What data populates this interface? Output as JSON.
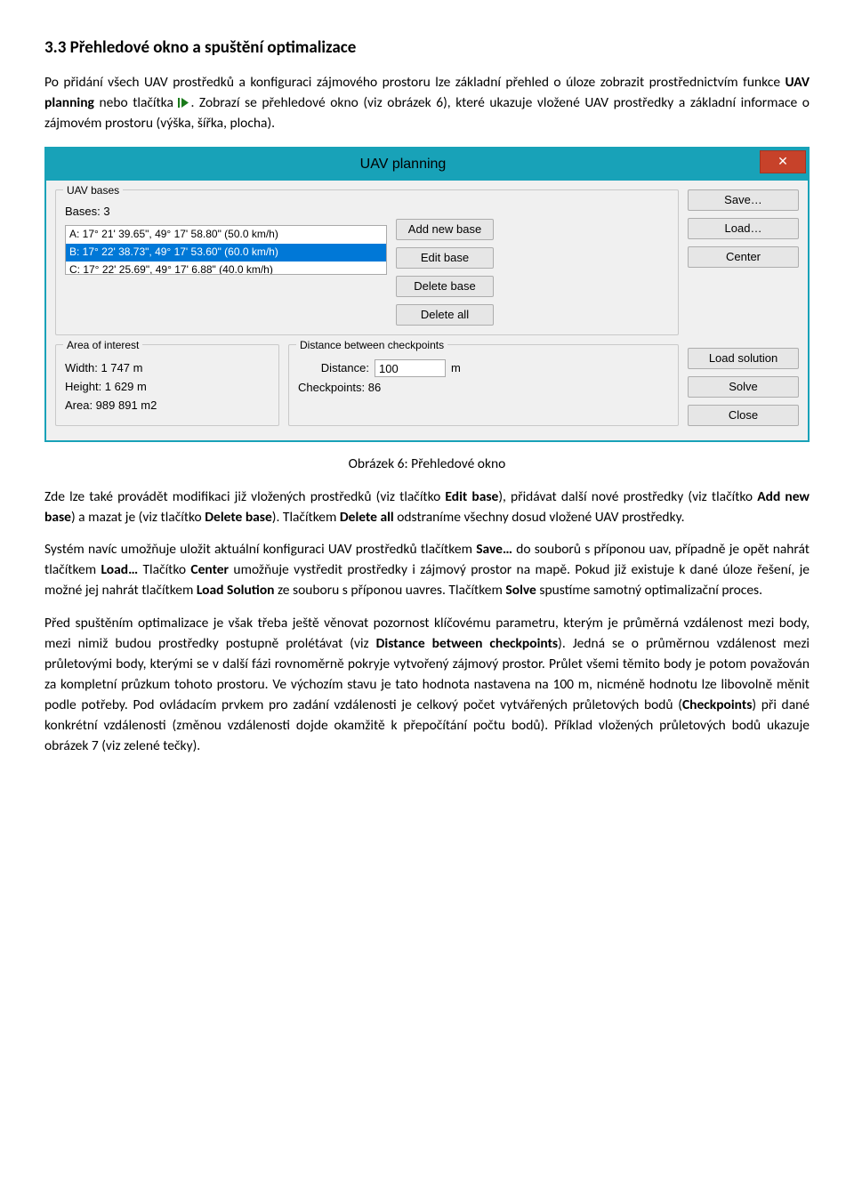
{
  "heading": "3.3 Přehledové okno a spuštění optimalizace",
  "para1": {
    "t1": "Po přidání všech UAV prostředků a konfiguraci zájmového prostoru lze základní přehled o úloze zobrazit prostřednictvím funkce ",
    "b1": "UAV planning",
    "t2": " nebo tlačítka ",
    "t3": ". Zobrazí se přehledové okno (viz obrázek 6), které ukazuje vložené UAV prostředky a základní informace o zájmovém prostoru (výška, šířka, plocha)."
  },
  "win": {
    "title": "UAV planning",
    "close": "✕",
    "bases_group": "UAV bases",
    "bases_label": "Bases:  3",
    "list": {
      "a": "A: 17° 21' 39.65\", 49° 17' 58.80\" (50.0 km/h)",
      "b": "B: 17° 22' 38.73\", 49° 17' 53.60\" (60.0 km/h)",
      "c": "C: 17° 22' 25.69\", 49° 17' 6.88\" (40.0 km/h)"
    },
    "btn_add": "Add new base",
    "btn_edit": "Edit base",
    "btn_delete": "Delete base",
    "btn_delete_all": "Delete all",
    "aoi_group": "Area of interest",
    "width": "Width:   1 747 m",
    "height": "Height:  1 629 m",
    "area": "Area:    989 891 m2",
    "dist_group": "Distance between checkpoints",
    "dist_label": "Distance:",
    "dist_value": "100",
    "dist_unit": "m",
    "chk_label": "Checkpoints:  86",
    "btn_save": "Save…",
    "btn_load": "Load…",
    "btn_center": "Center",
    "btn_loadsol": "Load solution",
    "btn_solve": "Solve",
    "btn_close2": "Close"
  },
  "caption": "Obrázek 6: Přehledové okno",
  "para2": {
    "t1": "Zde lze také provádět modifikaci již vložených prostředků (viz tlačítko ",
    "b1": "Edit base",
    "t2": "), přidávat další nové prostředky (viz tlačítko ",
    "b2": "Add new base",
    "t3": ") a mazat je (viz tlačítko ",
    "b3": "Delete base",
    "t4": "). Tlačítkem ",
    "b4": "Delete all",
    "t5": " odstraníme všechny dosud vložené UAV prostředky."
  },
  "para3": {
    "t1": "Systém navíc umožňuje uložit aktuální konfiguraci UAV prostředků tlačítkem ",
    "b1": "Save…",
    "t2": " do souborů s příponou uav, případně je opět nahrát tlačítkem ",
    "b2": "Load…",
    "t3": " Tlačítko ",
    "b3": "Center",
    "t4": " umožňuje vystředit prostředky i zájmový prostor na mapě. Pokud již existuje k dané úloze řešení, je možné jej nahrát tlačítkem ",
    "b4": "Load Solution",
    "t5": " ze souboru s příponou uavres. Tlačítkem ",
    "b5": "Solve",
    "t6": " spustíme samotný optimalizační proces."
  },
  "para4": {
    "t1": "Před spuštěním optimalizace je však třeba ještě věnovat pozornost klíčovému parametru, kterým je průměrná vzdálenost mezi body, mezi nimiž budou prostředky postupně prolétávat (viz ",
    "b1": "Distance between checkpoints",
    "t2": "). Jedná se o průměrnou vzdálenost mezi průletovými body, kterými se v další fázi rovnoměrně pokryje vytvořený zájmový prostor. Průlet všemi těmito body je potom považován za kompletní průzkum tohoto prostoru. Ve výchozím stavu je tato hodnota nastavena na 100 m, nicméně hodnotu lze libovolně měnit podle potřeby. Pod ovládacím prvkem pro zadání vzdálenosti je celkový počet vytvářených průletových bodů (",
    "b2": "Checkpoints",
    "t3": ") při dané konkrétní vzdálenosti (změnou vzdálenosti dojde okamžitě k přepočítání počtu bodů). Příklad vložených průletových bodů ukazuje obrázek 7 (viz zelené tečky)."
  }
}
